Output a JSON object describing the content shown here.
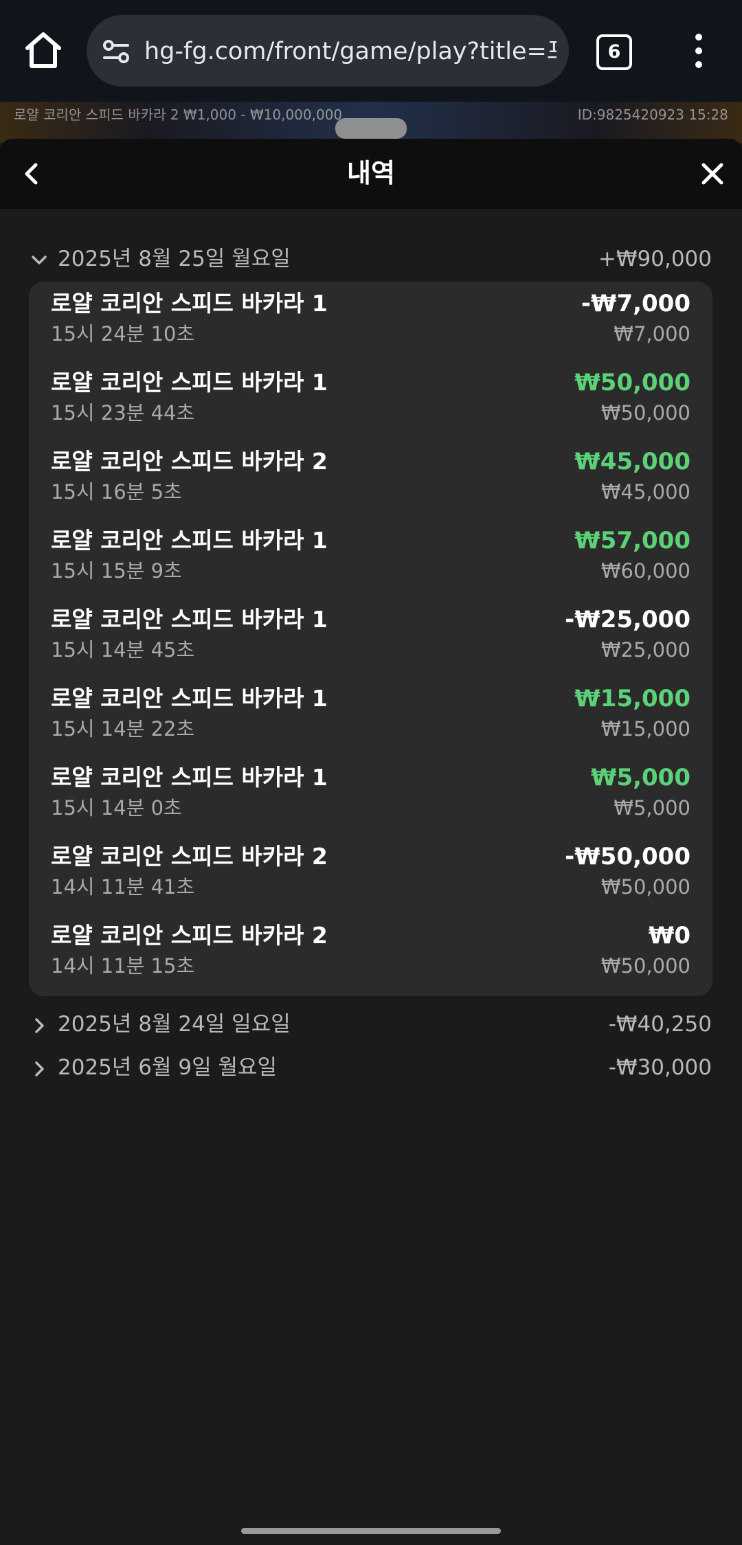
{
  "browser": {
    "url": "hg-fg.com/front/game/play?title=프",
    "tab_count": "6",
    "icons": {
      "home": "home-icon",
      "site": "site-settings-icon",
      "menu": "more-vert-icon"
    }
  },
  "game": {
    "info": "로얄 코리안 스피드 바카라 2  ₩1,000 - ₩10,000,000",
    "id": "ID:9825420923  15:28"
  },
  "modal": {
    "title": "내역",
    "icons": {
      "back": "chevron-left-icon",
      "close": "close-icon"
    }
  },
  "days": [
    {
      "date": "2025년 8월 25일 월요일",
      "total": "+₩90,000",
      "expanded": true
    },
    {
      "date": "2025년 8월 24일 일요일",
      "total": "-₩40,250",
      "expanded": false
    },
    {
      "date": "2025년 6월 9일 월요일",
      "total": "-₩30,000",
      "expanded": false
    }
  ],
  "transactions": [
    {
      "title": "로얄 코리안 스피드 바카라 1",
      "time": "15시 24분 10초",
      "result": "-₩7,000",
      "result_type": "loss",
      "bet": "₩7,000"
    },
    {
      "title": "로얄 코리안 스피드 바카라 1",
      "time": "15시 23분 44초",
      "result": "₩50,000",
      "result_type": "win",
      "bet": "₩50,000"
    },
    {
      "title": "로얄 코리안 스피드 바카라 2",
      "time": "15시 16분 5초",
      "result": "₩45,000",
      "result_type": "win",
      "bet": "₩45,000"
    },
    {
      "title": "로얄 코리안 스피드 바카라 1",
      "time": "15시 15분 9초",
      "result": "₩57,000",
      "result_type": "win",
      "bet": "₩60,000"
    },
    {
      "title": "로얄 코리안 스피드 바카라 1",
      "time": "15시 14분 45초",
      "result": "-₩25,000",
      "result_type": "loss",
      "bet": "₩25,000"
    },
    {
      "title": "로얄 코리안 스피드 바카라 1",
      "time": "15시 14분 22초",
      "result": "₩15,000",
      "result_type": "win",
      "bet": "₩15,000"
    },
    {
      "title": "로얄 코리안 스피드 바카라 1",
      "time": "15시 14분 0초",
      "result": "₩5,000",
      "result_type": "win",
      "bet": "₩5,000"
    },
    {
      "title": "로얄 코리안 스피드 바카라 2",
      "time": "14시 11분 41초",
      "result": "-₩50,000",
      "result_type": "loss",
      "bet": "₩50,000"
    },
    {
      "title": "로얄 코리안 스피드 바카라 2",
      "time": "14시 11분 15초",
      "result": "₩0",
      "result_type": "zero",
      "bet": "₩50,000"
    }
  ],
  "colors": {
    "win": "#5bd178",
    "loss": "#ffffff",
    "background": "#1b1b1b",
    "card": "#2b2b2b"
  }
}
